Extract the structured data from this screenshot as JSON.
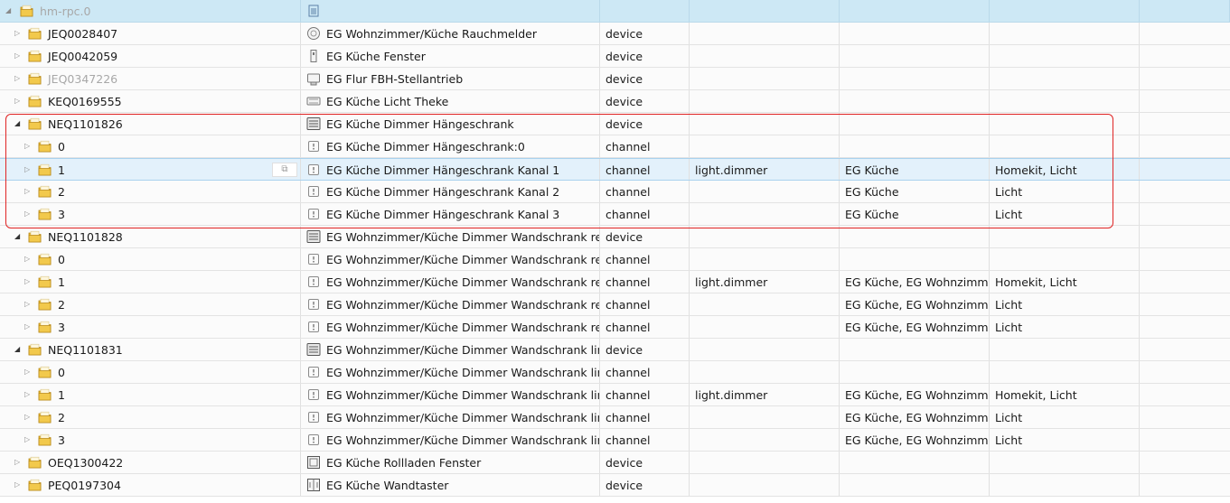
{
  "header": {
    "root_label": "hm-rpc.0",
    "root_icon": "adapter-icon"
  },
  "rows": [
    {
      "level": 1,
      "expanded": false,
      "id": "JEQ0028407",
      "dim": false,
      "icon": "smoke-detector-icon",
      "name": "EG Wohnzimmer/Küche Rauchmelder",
      "type": "device",
      "role": "",
      "room": "",
      "function": ""
    },
    {
      "level": 1,
      "expanded": false,
      "id": "JEQ0042059",
      "dim": false,
      "icon": "window-sensor-icon",
      "name": "EG Küche Fenster",
      "type": "device",
      "role": "",
      "room": "",
      "function": ""
    },
    {
      "level": 1,
      "expanded": false,
      "id": "JEQ0347226",
      "dim": true,
      "icon": "valve-actuator-icon",
      "name": "EG Flur FBH-Stellantrieb",
      "type": "device",
      "role": "",
      "room": "",
      "function": ""
    },
    {
      "level": 1,
      "expanded": false,
      "id": "KEQ0169555",
      "dim": false,
      "icon": "switch-actuator-icon",
      "name": "EG Küche Licht Theke",
      "type": "device",
      "role": "",
      "room": "",
      "function": ""
    },
    {
      "level": 1,
      "expanded": true,
      "id": "NEQ1101826",
      "dim": false,
      "icon": "dimmer-device-icon",
      "name": "EG Küche Dimmer Hängeschrank",
      "type": "device",
      "role": "",
      "room": "",
      "function": ""
    },
    {
      "level": 2,
      "expanded": false,
      "id": "0",
      "dim": false,
      "icon": "channel-icon",
      "name": "EG Küche Dimmer Hängeschrank:0",
      "type": "channel",
      "role": "",
      "room": "",
      "function": ""
    },
    {
      "level": 2,
      "expanded": false,
      "id": "1",
      "dim": false,
      "icon": "channel-icon",
      "name": "EG Küche Dimmer Hängeschrank Kanal 1",
      "type": "channel",
      "role": "light.dimmer",
      "room": "EG Küche",
      "function": "Homekit, Licht",
      "selected": true
    },
    {
      "level": 2,
      "expanded": false,
      "id": "2",
      "dim": false,
      "icon": "channel-icon",
      "name": "EG Küche Dimmer Hängeschrank Kanal 2",
      "type": "channel",
      "role": "",
      "room": "EG Küche",
      "function": "Licht"
    },
    {
      "level": 2,
      "expanded": false,
      "id": "3",
      "dim": false,
      "icon": "channel-icon",
      "name": "EG Küche Dimmer Hängeschrank Kanal 3",
      "type": "channel",
      "role": "",
      "room": "EG Küche",
      "function": "Licht"
    },
    {
      "level": 1,
      "expanded": true,
      "id": "NEQ1101828",
      "dim": false,
      "icon": "dimmer-device-icon",
      "name": "EG Wohnzimmer/Küche Dimmer Wandschrank rec...",
      "type": "device",
      "role": "",
      "room": "",
      "function": ""
    },
    {
      "level": 2,
      "expanded": false,
      "id": "0",
      "dim": false,
      "icon": "channel-icon",
      "name": "EG Wohnzimmer/Küche Dimmer Wandschrank rec...",
      "type": "channel",
      "role": "",
      "room": "",
      "function": ""
    },
    {
      "level": 2,
      "expanded": false,
      "id": "1",
      "dim": false,
      "icon": "channel-icon",
      "name": "EG Wohnzimmer/Küche Dimmer Wandschrank rec...",
      "type": "channel",
      "role": "light.dimmer",
      "room": "EG Küche, EG Wohnzimmer",
      "function": "Homekit, Licht"
    },
    {
      "level": 2,
      "expanded": false,
      "id": "2",
      "dim": false,
      "icon": "channel-icon",
      "name": "EG Wohnzimmer/Küche Dimmer Wandschrank rec...",
      "type": "channel",
      "role": "",
      "room": "EG Küche, EG Wohnzimmer",
      "function": "Licht"
    },
    {
      "level": 2,
      "expanded": false,
      "id": "3",
      "dim": false,
      "icon": "channel-icon",
      "name": "EG Wohnzimmer/Küche Dimmer Wandschrank rec...",
      "type": "channel",
      "role": "",
      "room": "EG Küche, EG Wohnzimmer",
      "function": "Licht"
    },
    {
      "level": 1,
      "expanded": true,
      "id": "NEQ1101831",
      "dim": false,
      "icon": "dimmer-device-icon",
      "name": "EG Wohnzimmer/Küche Dimmer Wandschrank links",
      "type": "device",
      "role": "",
      "room": "",
      "function": ""
    },
    {
      "level": 2,
      "expanded": false,
      "id": "0",
      "dim": false,
      "icon": "channel-icon",
      "name": "EG Wohnzimmer/Küche Dimmer Wandschrank link...",
      "type": "channel",
      "role": "",
      "room": "",
      "function": ""
    },
    {
      "level": 2,
      "expanded": false,
      "id": "1",
      "dim": false,
      "icon": "channel-icon",
      "name": "EG Wohnzimmer/Küche Dimmer Wandschrank link...",
      "type": "channel",
      "role": "light.dimmer",
      "room": "EG Küche, EG Wohnzimmer",
      "function": "Homekit, Licht"
    },
    {
      "level": 2,
      "expanded": false,
      "id": "2",
      "dim": false,
      "icon": "channel-icon",
      "name": "EG Wohnzimmer/Küche Dimmer Wandschrank link...",
      "type": "channel",
      "role": "",
      "room": "EG Küche, EG Wohnzimmer",
      "function": "Licht"
    },
    {
      "level": 2,
      "expanded": false,
      "id": "3",
      "dim": false,
      "icon": "channel-icon",
      "name": "EG Wohnzimmer/Küche Dimmer Wandschrank link...",
      "type": "channel",
      "role": "",
      "room": "EG Küche, EG Wohnzimmer",
      "function": "Licht"
    },
    {
      "level": 1,
      "expanded": false,
      "id": "OEQ1300422",
      "dim": false,
      "icon": "blind-actuator-icon",
      "name": "EG Küche Rollladen Fenster",
      "type": "device",
      "role": "",
      "room": "",
      "function": ""
    },
    {
      "level": 1,
      "expanded": false,
      "id": "PEQ0197304",
      "dim": false,
      "icon": "wall-switch-icon",
      "name": "EG Küche Wandtaster",
      "type": "device",
      "role": "",
      "room": "",
      "function": ""
    }
  ],
  "colors": {
    "header_bg": "#cde8f5",
    "folder": "#e8b82a",
    "highlight": "#e02424",
    "selected_bg": "#e3f1fb"
  }
}
